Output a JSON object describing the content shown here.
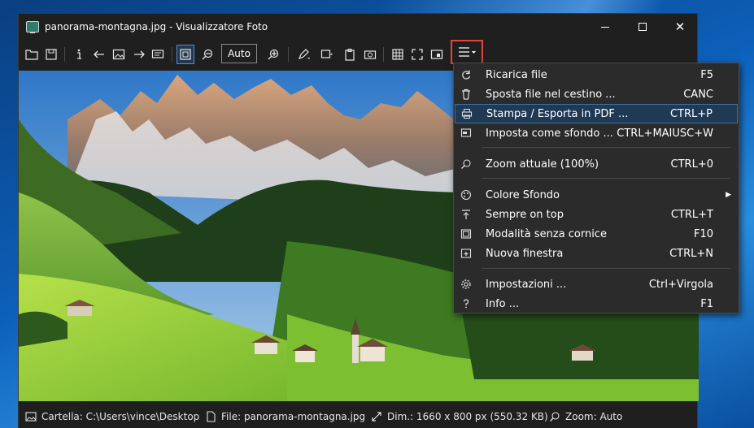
{
  "window": {
    "title": "panorama-montagna.jpg - Visualizzatore Foto",
    "minimize_icon": "minimize-icon",
    "maximize_icon": "maximize-icon",
    "close_glyph": "✕"
  },
  "toolbar": {
    "zoom_value": "Auto",
    "icons": [
      "open-folder-icon",
      "save-icon",
      "info-icon",
      "arrow-left-icon",
      "image-icon",
      "arrow-right-icon",
      "slideshow-icon",
      "fit-window-icon",
      "zoom-out-icon",
      "zoom-in-icon",
      "edit-icon",
      "frame-icon",
      "clipboard-icon",
      "camera-icon",
      "grid-icon",
      "fullscreen-icon",
      "window-icon",
      "hamburger-menu-icon"
    ]
  },
  "menu": {
    "items": [
      {
        "label": "Ricarica file",
        "shortcut": "F5",
        "icon": "refresh-icon"
      },
      {
        "label": "Sposta file nel cestino ...",
        "shortcut": "CANC",
        "icon": "trash-icon"
      },
      {
        "label": "Stampa / Esporta in PDF ...",
        "shortcut": "CTRL+P",
        "icon": "printer-icon",
        "highlighted": true
      },
      {
        "label": "Imposta come sfondo ...",
        "shortcut": "CTRL+MAIUSC+W",
        "icon": "wallpaper-icon"
      },
      {
        "label": "Zoom attuale (100%)",
        "shortcut": "CTRL+0",
        "icon": "zoom-icon"
      },
      {
        "label": "Colore Sfondo",
        "shortcut": "",
        "icon": "palette-icon",
        "submenu": true
      },
      {
        "label": "Sempre on top",
        "shortcut": "CTRL+T",
        "icon": "pin-top-icon"
      },
      {
        "label": "Modalità senza cornice",
        "shortcut": "F10",
        "icon": "frameless-icon"
      },
      {
        "label": "Nuova finestra",
        "shortcut": "CTRL+N",
        "icon": "new-window-icon"
      },
      {
        "label": "Impostazioni ...",
        "shortcut": "Ctrl+Virgola",
        "icon": "settings-icon"
      },
      {
        "label": "Info ...",
        "shortcut": "F1",
        "icon": "help-icon"
      }
    ],
    "submenu_arrow": "▶"
  },
  "status": {
    "folder": "Cartella: C:\\Users\\vince\\Desktop",
    "file": "File: panorama-montagna.jpg",
    "dimensions": "Dim.: 1660 x 800 px (550.32 KB)",
    "zoom": "Zoom: Auto"
  },
  "colors": {
    "accent": "#4a90d9",
    "highlight_border": "#e2463b",
    "menu_bg": "#2b2b2b",
    "window_bg": "#1f1f1f"
  }
}
